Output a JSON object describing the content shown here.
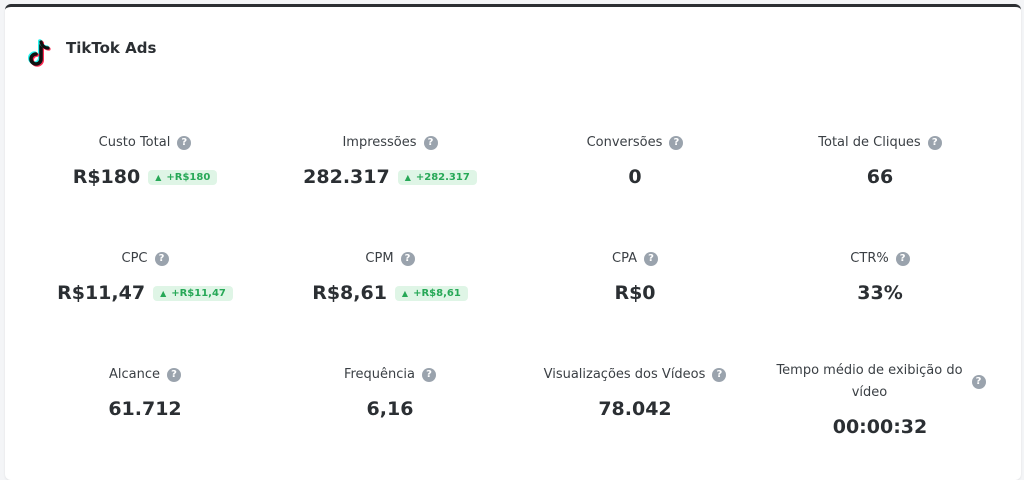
{
  "header": {
    "title": "TikTok Ads",
    "icon": "tiktok-logo-icon"
  },
  "help_icon": "question-icon",
  "metrics": {
    "custo_total": {
      "label": "Custo Total",
      "value": "R$180",
      "delta": "+R$180"
    },
    "impressoes": {
      "label": "Impressões",
      "value": "282.317",
      "delta": "+282.317"
    },
    "conversoes": {
      "label": "Conversões",
      "value": "0"
    },
    "total_cliques": {
      "label": "Total de Cliques",
      "value": "66"
    },
    "cpc": {
      "label": "CPC",
      "value": "R$11,47",
      "delta": "+R$11,47"
    },
    "cpm": {
      "label": "CPM",
      "value": "R$8,61",
      "delta": "+R$8,61"
    },
    "cpa": {
      "label": "CPA",
      "value": "R$0"
    },
    "ctr": {
      "label": "CTR%",
      "value": "33%"
    },
    "alcance": {
      "label": "Alcance",
      "value": "61.712"
    },
    "frequencia": {
      "label": "Frequência",
      "value": "6,16"
    },
    "visualizacoes": {
      "label": "Visualizações dos Vídeos",
      "value": "78.042"
    },
    "tempo_medio": {
      "label": "Tempo médio de exibição do vídeo",
      "value": "00:00:32"
    }
  },
  "colors": {
    "delta_text": "#27a857",
    "delta_bg": "#dff5e6",
    "help_icon": "#9aa3ad",
    "card_border": "#2c2f33"
  }
}
